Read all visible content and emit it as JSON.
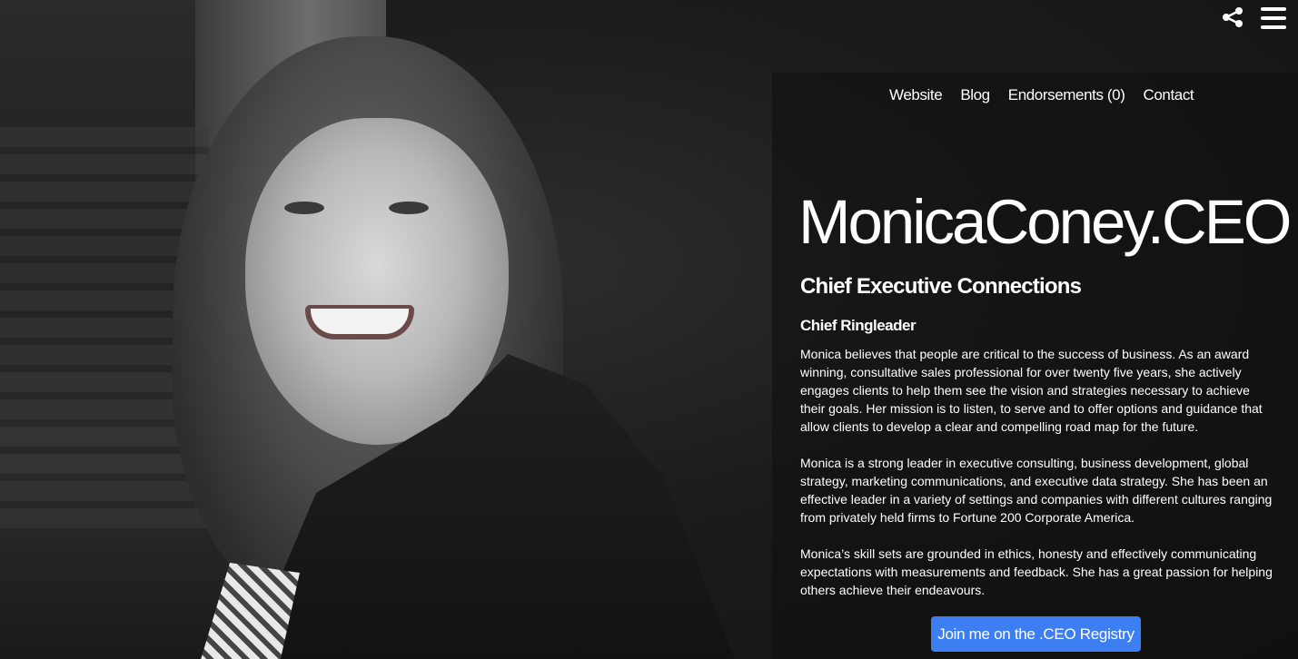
{
  "header": {
    "share_icon": "share-icon",
    "menu_icon": "hamburger-menu-icon"
  },
  "nav": {
    "items": [
      {
        "label": "Website"
      },
      {
        "label": "Blog"
      },
      {
        "label": "Endorsements (0)"
      },
      {
        "label": "Contact"
      }
    ]
  },
  "profile": {
    "title": "MonicaConey.CEO",
    "subtitle": "Chief Executive Connections",
    "role": "Chief Ringleader",
    "bio": [
      "Monica believes that people are critical to the success of business. As an award winning, consultative sales professional for over twenty five years, she actively engages clients to help them see the vision and strategies necessary to achieve their goals. Her mission is to listen, to serve and to offer options and guidance that allow clients to develop a clear and compelling road map for the future.",
      "Monica is a strong leader in executive consulting, business development, global strategy, marketing communications, and executive data strategy. She has been an effective leader in a variety of settings and companies with different cultures ranging from privately held firms to Fortune 200 Corporate America.",
      "Monica’s skill sets are grounded in ethics, honesty and effectively communicating expectations with measurements and feedback. She has a great passion for helping others achieve their endeavours."
    ],
    "cta_label": "Join me on the .CEO Registry"
  },
  "colors": {
    "accent": "#3d7ef2",
    "background": "#141414",
    "text": "#ffffff"
  }
}
